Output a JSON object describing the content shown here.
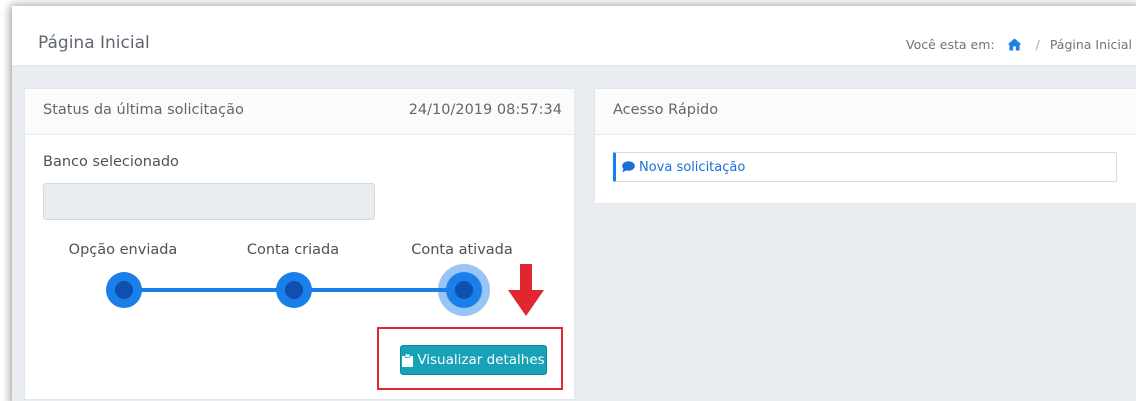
{
  "header": {
    "page_title": "Página Inicial",
    "breadcrumb_prefix": "Você esta em:",
    "breadcrumb_separator": "/",
    "breadcrumb_current": "Página Inicial",
    "home_icon": "home-icon"
  },
  "status_card": {
    "title": "Status da última solicitação",
    "datetime": "24/10/2019 08:57:34",
    "bank_label": "Banco selecionado",
    "bank_value": "",
    "steps": [
      {
        "label": "Opção enviada"
      },
      {
        "label": "Conta criada"
      },
      {
        "label": "Conta ativada"
      }
    ],
    "details_button": "Visualizar detalhes",
    "details_icon": "clipboard-icon"
  },
  "quick_card": {
    "title": "Acesso Rápido",
    "items": [
      {
        "label": "Nova solicitação",
        "icon": "comment-icon"
      }
    ]
  },
  "colors": {
    "accent": "#1a7fe8",
    "button": "#17a2b8",
    "annotation": "#e0272f"
  }
}
